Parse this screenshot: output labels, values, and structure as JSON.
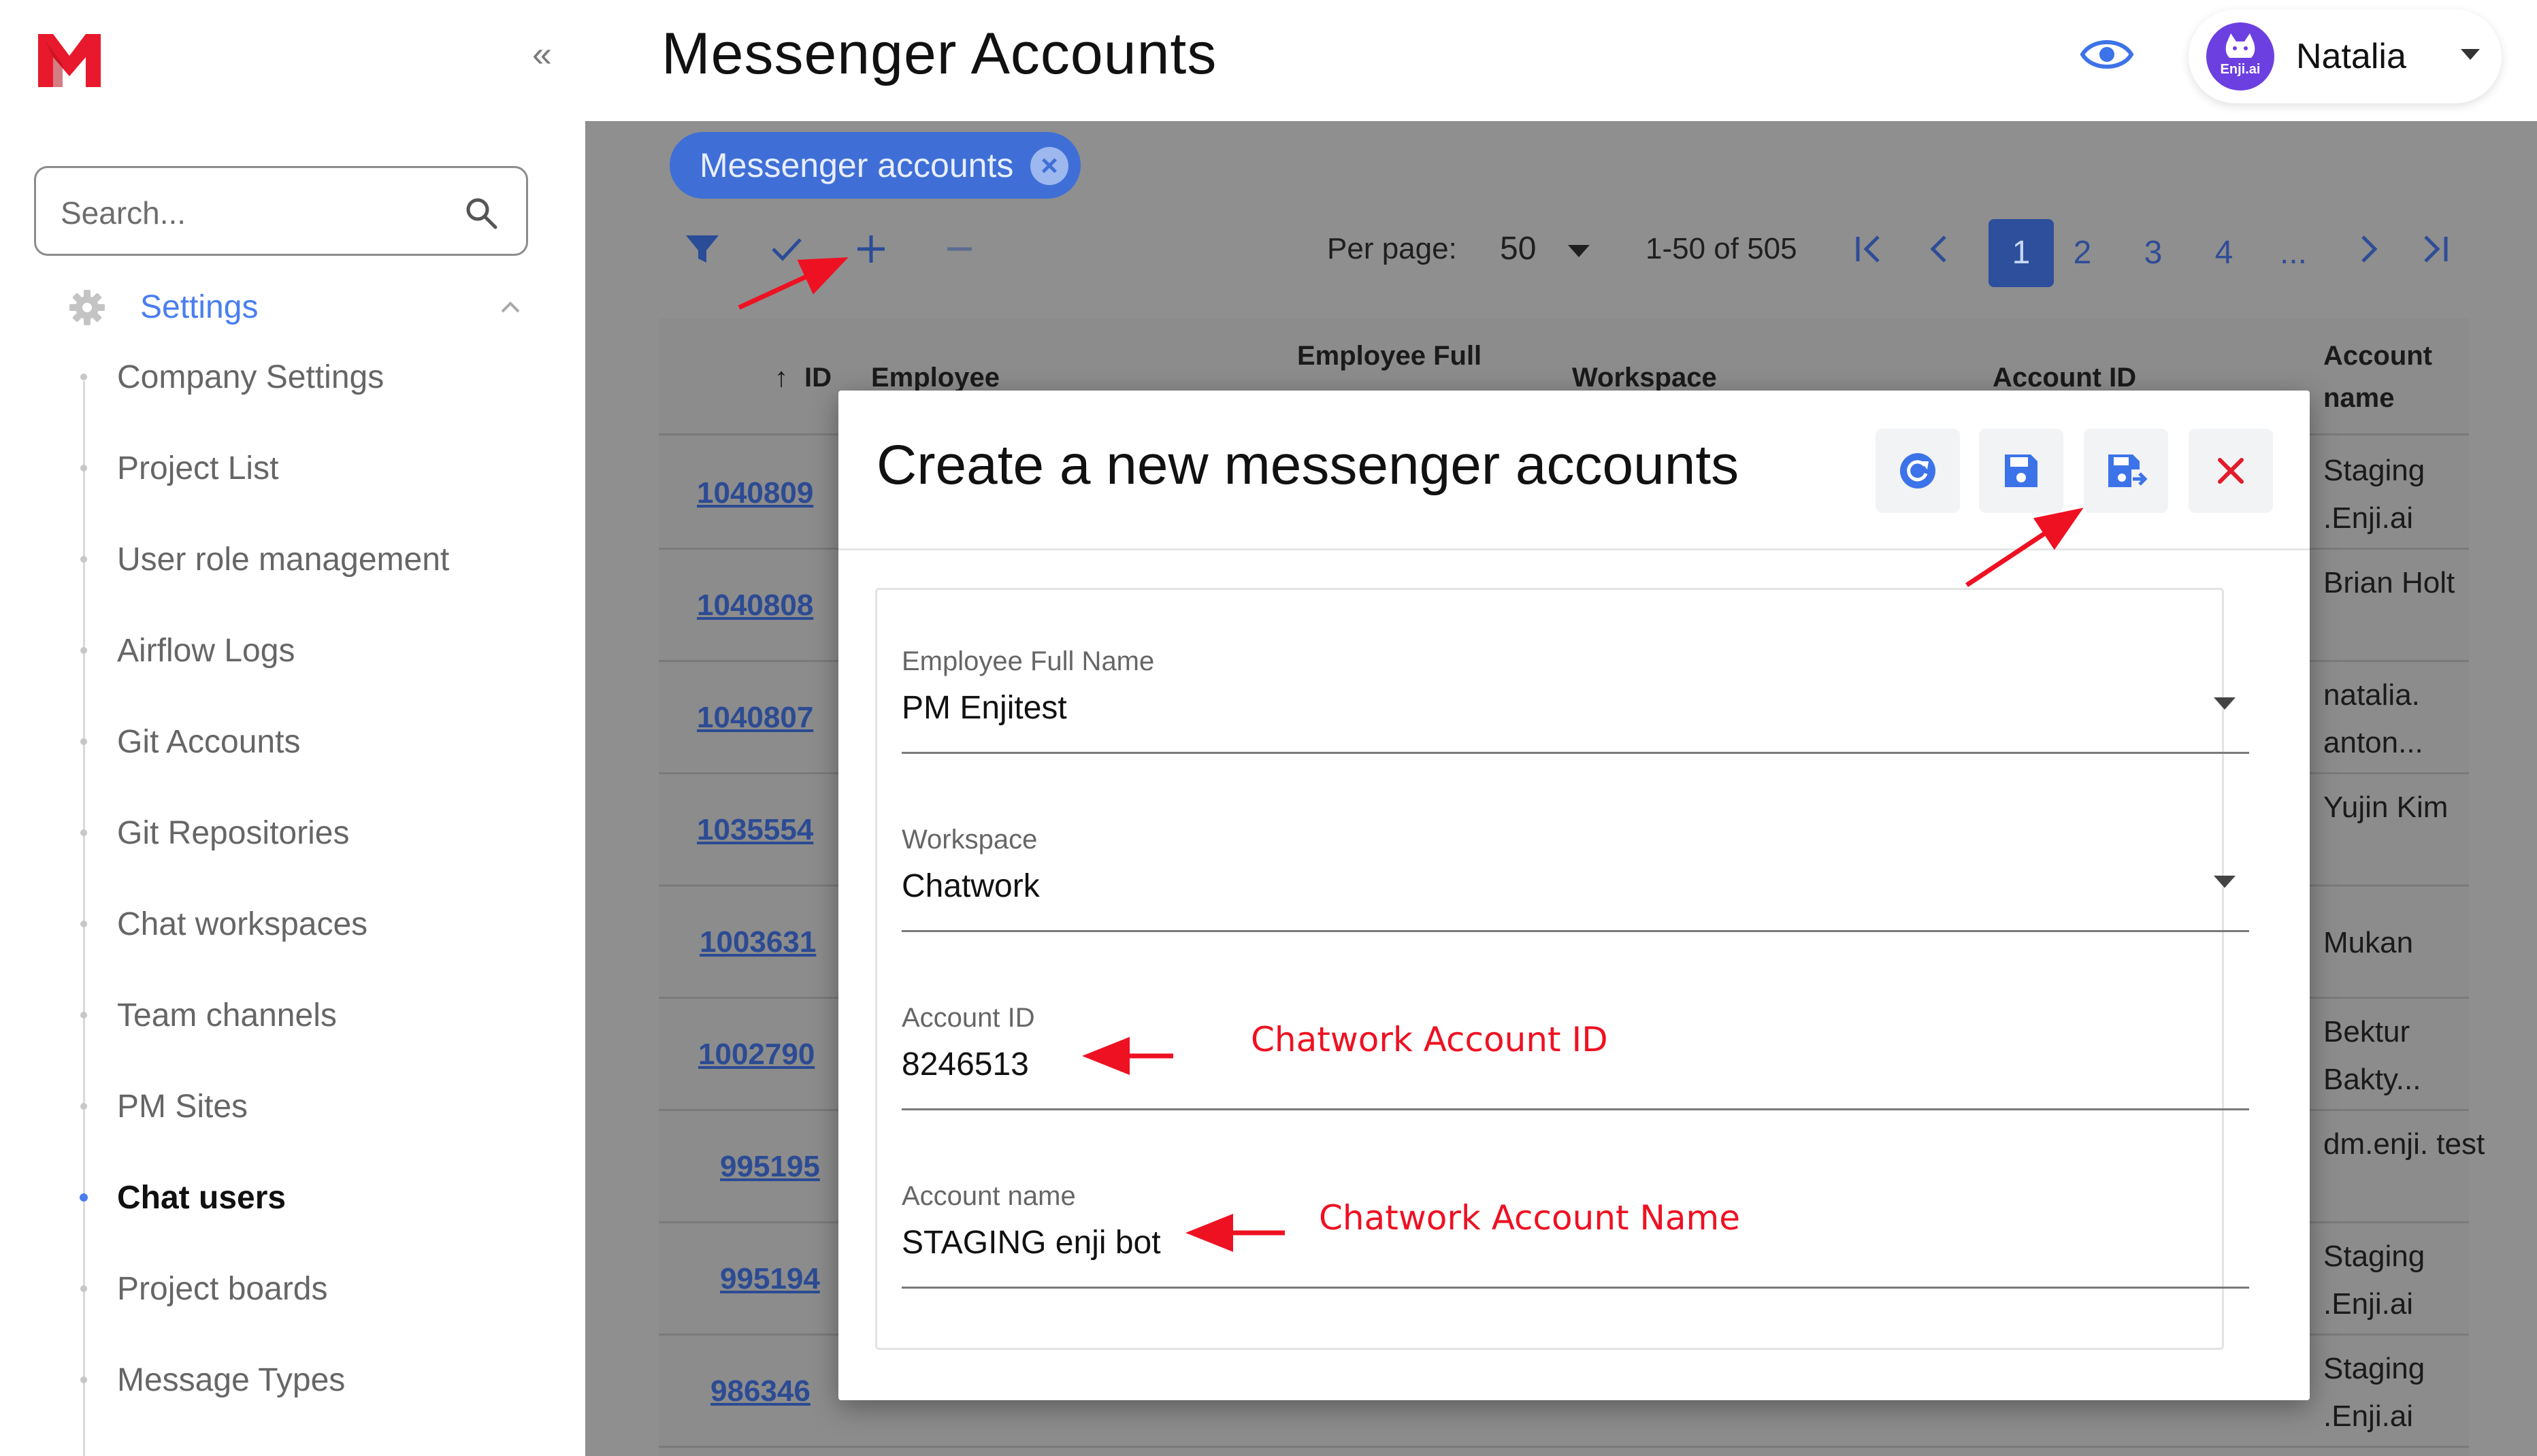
{
  "brand": {
    "accent": "#4a7ef0",
    "logo_color": "#e8192c"
  },
  "sidebar": {
    "search_placeholder": "Search...",
    "section_label": "Settings",
    "items": [
      {
        "label": "Company Settings",
        "active": false
      },
      {
        "label": "Project List",
        "active": false
      },
      {
        "label": "User role management",
        "active": false
      },
      {
        "label": "Airflow Logs",
        "active": false
      },
      {
        "label": "Git Accounts",
        "active": false
      },
      {
        "label": "Git Repositories",
        "active": false
      },
      {
        "label": "Chat workspaces",
        "active": false
      },
      {
        "label": "Team channels",
        "active": false
      },
      {
        "label": "PM Sites",
        "active": false
      },
      {
        "label": "Chat users",
        "active": true
      },
      {
        "label": "Project boards",
        "active": false
      },
      {
        "label": "Message Types",
        "active": false
      }
    ]
  },
  "header": {
    "title": "Messenger Accounts",
    "user_name": "Natalia",
    "avatar_text": "Enji.ai"
  },
  "filters": {
    "chip_label": "Messenger accounts"
  },
  "pagination": {
    "per_page_label": "Per page:",
    "per_page_value": "50",
    "range": "1-50 of 505",
    "pages": [
      "1",
      "2",
      "3",
      "4",
      "..."
    ],
    "current_page": "1"
  },
  "table": {
    "columns": {
      "id": "ID",
      "employee": "Employee",
      "employee_full": "Employee Full",
      "workspace": "Workspace",
      "account_id": "Account ID",
      "account_name": "Account name"
    },
    "rows": [
      {
        "id": "1040809",
        "account_name": "Staging .Enji.ai"
      },
      {
        "id": "1040808",
        "account_name": "Brian Holt"
      },
      {
        "id": "1040807",
        "account_name": "natalia. anton..."
      },
      {
        "id": "1035554",
        "account_name": "Yujin Kim"
      },
      {
        "id": "1003631",
        "account_name": "Mukan"
      },
      {
        "id": "1002790",
        "account_name": "Bektur Bakty..."
      },
      {
        "id": "995195",
        "account_name": "dm.enji. test"
      },
      {
        "id": "995194",
        "account_name": "Staging .Enji.ai"
      },
      {
        "id": "986346",
        "account_name": "Staging .Enji.ai"
      }
    ]
  },
  "modal": {
    "title": "Create a new messenger accounts",
    "fields": [
      {
        "label": "Employee Full Name",
        "value": "PM Enjitest",
        "type": "select"
      },
      {
        "label": "Workspace",
        "value": "Chatwork",
        "type": "select"
      },
      {
        "label": "Account ID",
        "value": "8246513",
        "type": "text"
      },
      {
        "label": "Account name",
        "value": "STAGING enji bot",
        "type": "text"
      }
    ]
  },
  "annotations": {
    "account_id_note": "Chatwork Account ID",
    "account_name_note": "Chatwork Account Name",
    "color": "#ee1122"
  }
}
